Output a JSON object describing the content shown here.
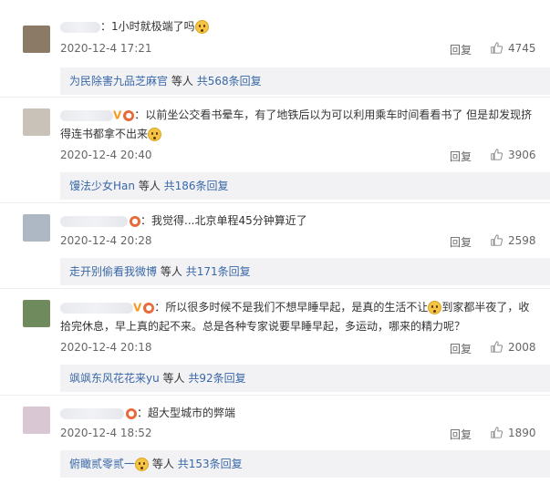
{
  "comments": [
    {
      "text": "1小时就极端了吗",
      "time": "2020-12-4 17:21",
      "reply_label": "回复",
      "likes": "4745",
      "sub_user": "为民除害九品芝麻官",
      "sub_mid": "等人",
      "sub_count": "共568条回复"
    },
    {
      "text": "以前坐公交看书晕车，有了地铁后以为可以利用乘车时间看看书了 但是却发现挤得连书都拿不出来",
      "time": "2020-12-4 20:40",
      "reply_label": "回复",
      "likes": "3906",
      "sub_user": "馒法少女Han",
      "sub_mid": "等人",
      "sub_count": "共186条回复"
    },
    {
      "text": "我觉得...北京单程45分钟算近了",
      "time": "2020-12-4 20:28",
      "reply_label": "回复",
      "likes": "2598",
      "sub_user": "走开别偷看我微博",
      "sub_mid": "等人",
      "sub_count": "共171条回复"
    },
    {
      "text_a": "所以很多时候不是我们不想早睡早起，是真的生活不让",
      "text_b": "到家都半夜了，收拾完休息，早上真的起不来。总是各种专家说要早睡早起，多运动，哪来的精力呢？",
      "time": "2020-12-4 20:18",
      "reply_label": "回复",
      "likes": "2008",
      "sub_user": "飒飒东风花花来yu",
      "sub_mid": "等人",
      "sub_count": "共92条回复"
    },
    {
      "text": "超大型城市的弊端",
      "time": "2020-12-4 18:52",
      "reply_label": "回复",
      "likes": "1890",
      "sub_user": "俯瞰贰零贰一",
      "sub_mid": "等人",
      "sub_count": "共153条回复"
    }
  ],
  "colors": {
    "link": "#3968a7",
    "subbar_bg": "#f2f2f5",
    "meta": "#666666"
  },
  "icons": {
    "like": "thumbs-up-icon",
    "emoji": "smiley-emoji-icon",
    "verified": "verified-v-icon",
    "level": "level-badge-icon"
  }
}
